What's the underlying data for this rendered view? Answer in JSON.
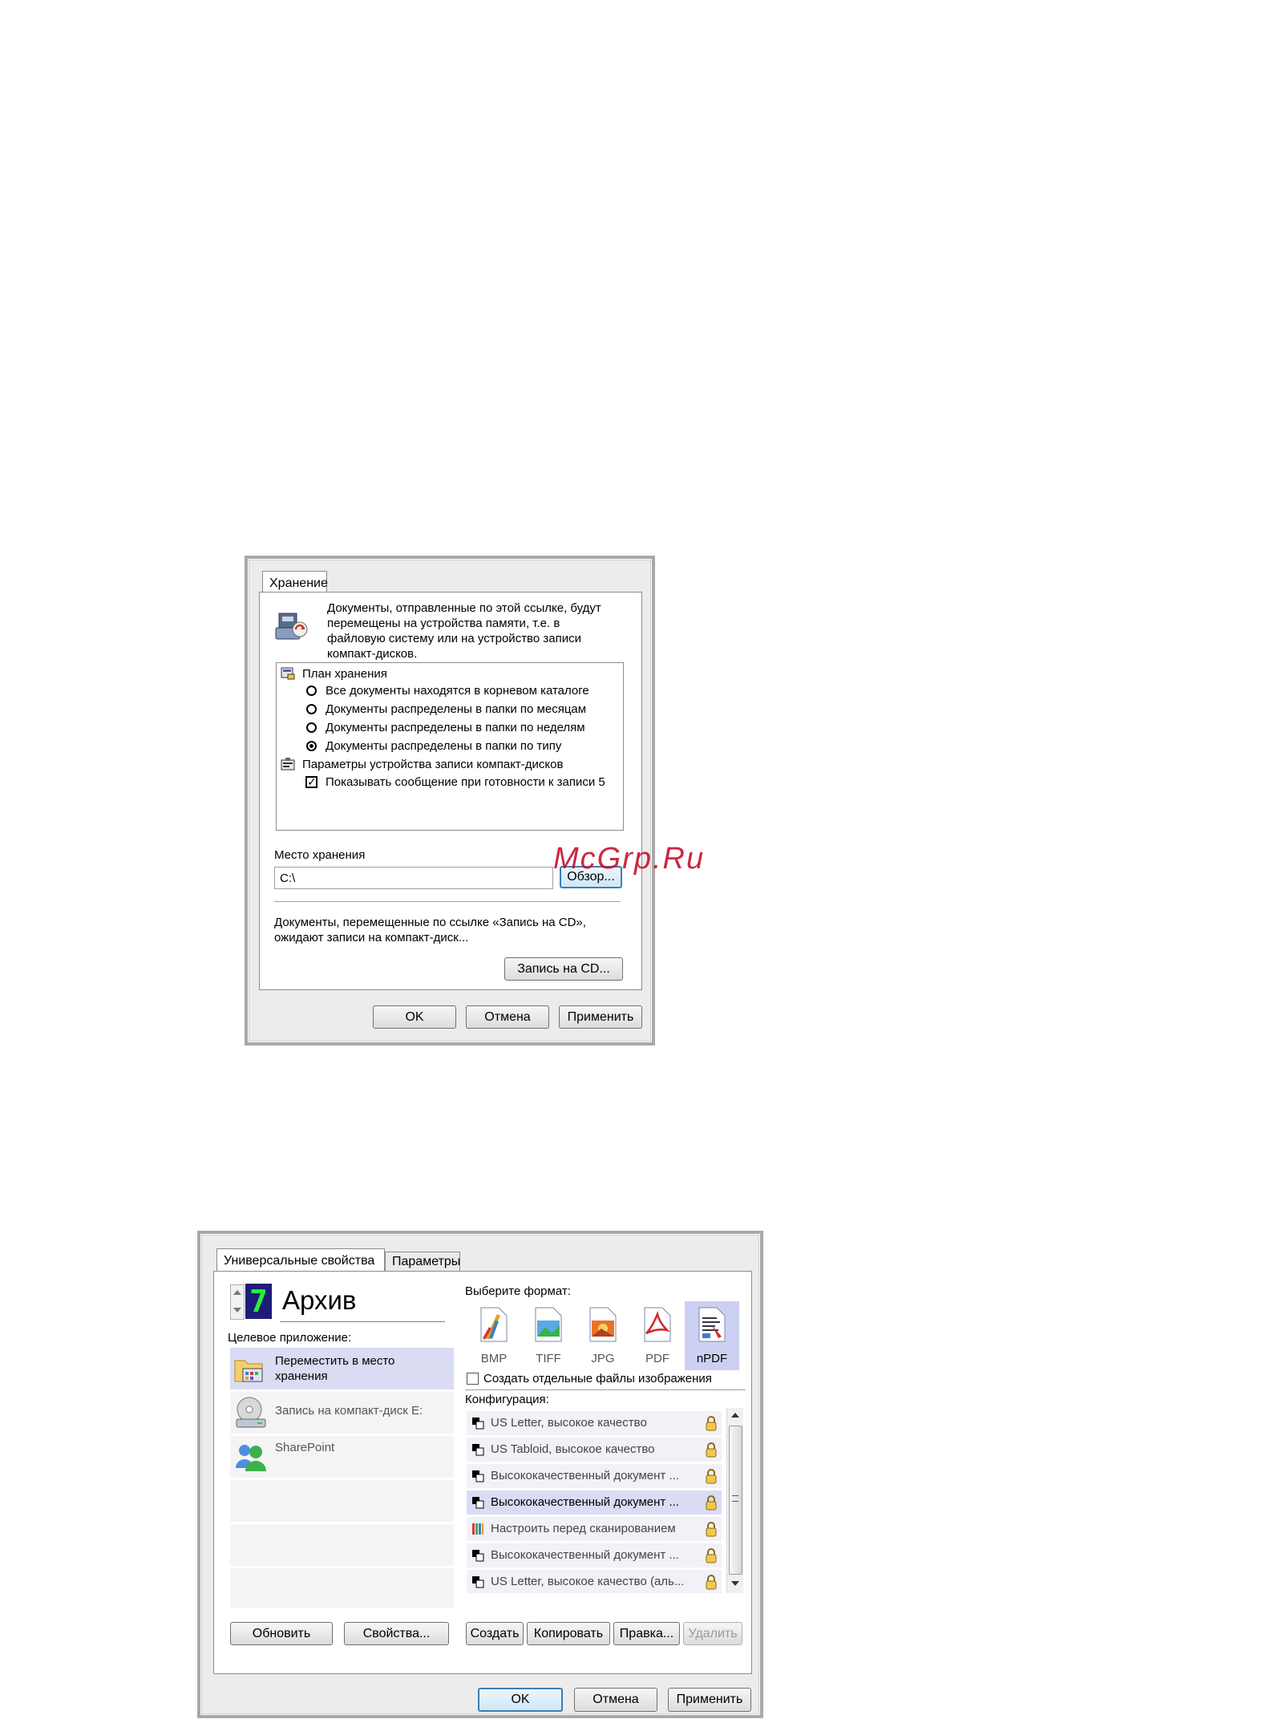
{
  "watermark": "McGrp.Ru",
  "dialog1": {
    "tab": "Хранение",
    "description": [
      "Документы, отправленные по этой ссылке, будут",
      "перемещены на устройства памяти, т.е. в",
      "файловую систему или на устройство записи",
      "компакт-дисков."
    ],
    "tree": {
      "group1": "План хранения",
      "options": [
        {
          "label": "Все документы находятся в корневом каталоге",
          "selected": false
        },
        {
          "label": "Документы распределены в папки по месяцам",
          "selected": false
        },
        {
          "label": "Документы распределены в папки по неделям",
          "selected": false
        },
        {
          "label": "Документы распределены в папки по типу",
          "selected": true
        }
      ],
      "group2": "Параметры устройства записи компакт-дисков",
      "checkbox_label": "Показывать сообщение при готовности к записи 5",
      "checkbox_checked": true
    },
    "location_label": "Место хранения",
    "location_value": "C:\\",
    "browse_button": "Обзор...",
    "cd_text": [
      "Документы, перемещенные по ссылке «Запись на CD»,",
      "ожидают записи на компакт-диск..."
    ],
    "burn_button": "Запись на CD...",
    "ok": "OK",
    "cancel": "Отмена",
    "apply": "Применить"
  },
  "dialog2": {
    "tabs": [
      "Универсальные свойства",
      "Параметры"
    ],
    "counter": "7",
    "name": "Архив",
    "target_label": "Целевое приложение:",
    "apps": [
      {
        "line1": "Переместить в место",
        "line2": "хранения",
        "icon": "folder-icon",
        "selected": true
      },
      {
        "line1": "Запись на компакт-диск  E:",
        "line2": "",
        "icon": "cd-drive-icon",
        "selected": false
      },
      {
        "line1": "SharePoint",
        "line2": "",
        "icon": "sharepoint-icon",
        "selected": false
      }
    ],
    "refresh_button": "Обновить",
    "properties_button": "Свойства...",
    "format_label": "Выберите формат:",
    "formats": [
      {
        "label": "BMP",
        "selected": false
      },
      {
        "label": "TIFF",
        "selected": false
      },
      {
        "label": "JPG",
        "selected": false
      },
      {
        "label": "PDF",
        "selected": false
      },
      {
        "label": "nPDF",
        "selected": true
      }
    ],
    "separate_files_label": "Создать отдельные файлы изображения",
    "separate_files_checked": false,
    "config_label": "Конфигурация:",
    "configs": [
      {
        "label": "US Letter, высокое качество",
        "selected": false
      },
      {
        "label": "US Tabloid, высокое качество",
        "selected": false
      },
      {
        "label": "Высококачественный документ ...",
        "selected": false
      },
      {
        "label": "Высококачественный документ ...",
        "selected": true
      },
      {
        "label": "Настроить перед сканированием",
        "selected": false
      },
      {
        "label": "Высококачественный документ ...",
        "selected": false
      },
      {
        "label": "US Letter, высокое качество (аль...",
        "selected": false
      }
    ],
    "create_button": "Создать",
    "copy_button": "Копировать",
    "edit_button": "Правка...",
    "delete_button": "Удалить",
    "ok": "OK",
    "cancel": "Отмена",
    "apply": "Применить"
  }
}
